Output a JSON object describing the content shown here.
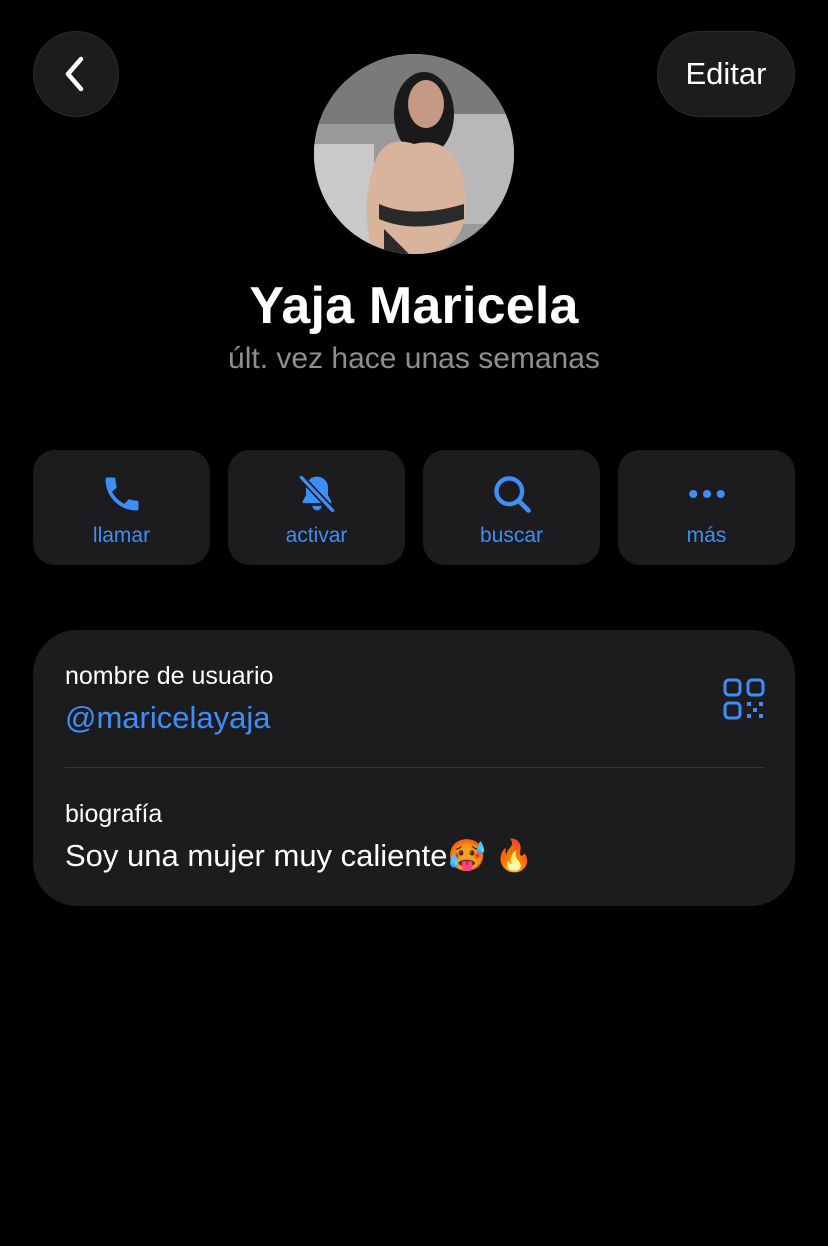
{
  "header": {
    "back_icon": "chevron-left-icon",
    "edit_label": "Editar"
  },
  "profile": {
    "name": "Yaja Maricela",
    "status": "últ. vez hace unas semanas",
    "avatar": "profile-photo"
  },
  "actions": [
    {
      "icon": "phone-icon",
      "label": "llamar"
    },
    {
      "icon": "bell-slash-icon",
      "label": "activar"
    },
    {
      "icon": "search-icon",
      "label": "buscar"
    },
    {
      "icon": "more-icon",
      "label": "más"
    }
  ],
  "info": {
    "username_label": "nombre de usuario",
    "username_value": "@maricelayaja",
    "qr_icon": "qr-code-icon",
    "bio_label": "biografía",
    "bio_value": "Soy una mujer muy caliente🥵 🔥"
  },
  "colors": {
    "accent": "#3e8ef7",
    "background": "#000000",
    "card": "#1c1c1e",
    "secondary_text": "#8e8e93"
  }
}
